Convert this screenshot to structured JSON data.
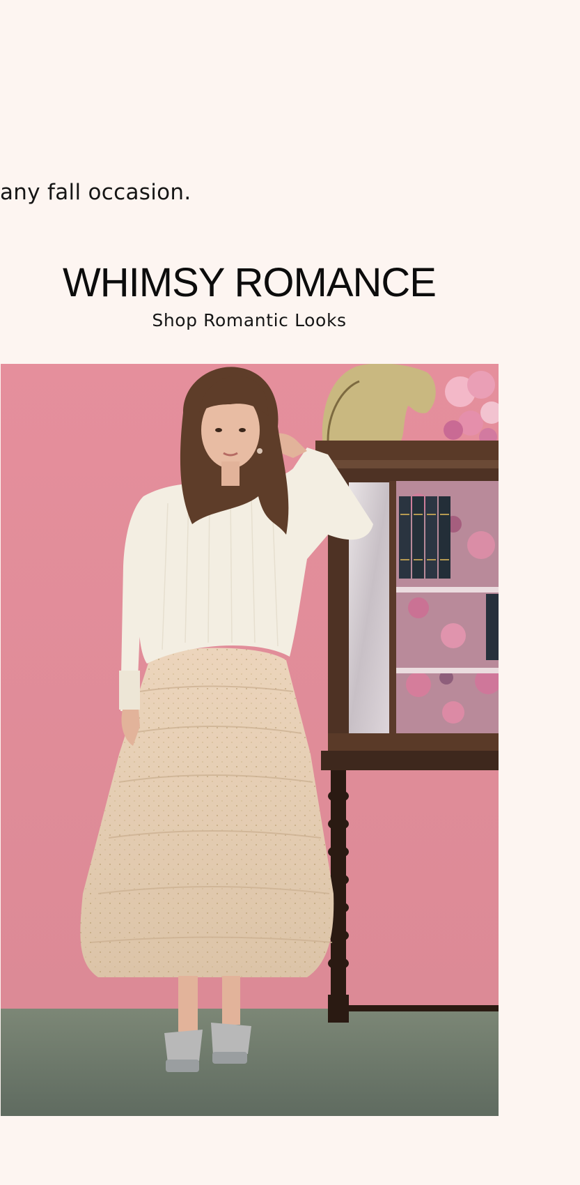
{
  "intro": {
    "text": "any fall occasion."
  },
  "section": {
    "heading": "WHIMSY ROMANCE",
    "link_label": "Shop Romantic Looks"
  },
  "hero": {
    "subject": "model-in-white-sweater-and-tiered-sequin-tulle-skirt",
    "colors": {
      "wall": "#e2929d",
      "floor": "#6f7a6c",
      "sweater": "#f3eee2",
      "skirt": "#e8cfb4",
      "cabinet": "#4a2f22",
      "hair": "#5a3b28"
    }
  }
}
